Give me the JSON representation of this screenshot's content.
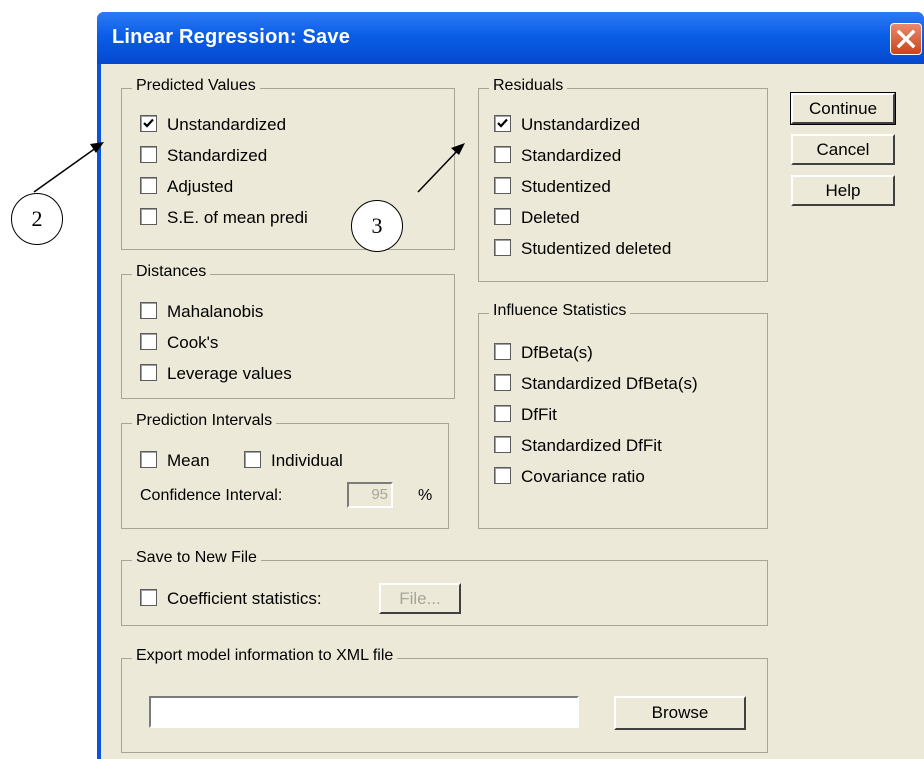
{
  "window": {
    "title": "Linear Regression: Save"
  },
  "predicted_values": {
    "legend": "Predicted Values",
    "items": [
      {
        "label": "Unstandardized",
        "checked": true
      },
      {
        "label": "Standardized",
        "checked": false
      },
      {
        "label": "Adjusted",
        "checked": false
      },
      {
        "label": "S.E. of mean predi",
        "checked": false
      }
    ]
  },
  "residuals": {
    "legend": "Residuals",
    "items": [
      {
        "label": "Unstandardized",
        "checked": true
      },
      {
        "label": "Standardized",
        "checked": false
      },
      {
        "label": "Studentized",
        "checked": false
      },
      {
        "label": "Deleted",
        "checked": false
      },
      {
        "label": "Studentized deleted",
        "checked": false
      }
    ]
  },
  "distances": {
    "legend": "Distances",
    "items": [
      {
        "label": "Mahalanobis",
        "checked": false
      },
      {
        "label": "Cook's",
        "checked": false
      },
      {
        "label": "Leverage values",
        "checked": false
      }
    ]
  },
  "influence_statistics": {
    "legend": "Influence Statistics",
    "items": [
      {
        "label": "DfBeta(s)",
        "checked": false
      },
      {
        "label": "Standardized DfBeta(s)",
        "checked": false
      },
      {
        "label": "DfFit",
        "checked": false
      },
      {
        "label": "Standardized DfFit",
        "checked": false
      },
      {
        "label": "Covariance ratio",
        "checked": false
      }
    ]
  },
  "prediction_intervals": {
    "legend": "Prediction Intervals",
    "mean_label": "Mean",
    "individual_label": "Individual",
    "ci_label": "Confidence Interval:",
    "ci_value": "95",
    "ci_unit": "%"
  },
  "save_to_new_file": {
    "legend": "Save to New File",
    "coefficient_label": "Coefficient statistics:",
    "file_button": "File..."
  },
  "export_xml": {
    "legend": "Export model information to XML file",
    "path_value": "",
    "browse_button": "Browse"
  },
  "buttons": {
    "continue": "Continue",
    "cancel": "Cancel",
    "help": "Help"
  },
  "annotations": {
    "callout_left": "2",
    "callout_right": "3"
  }
}
